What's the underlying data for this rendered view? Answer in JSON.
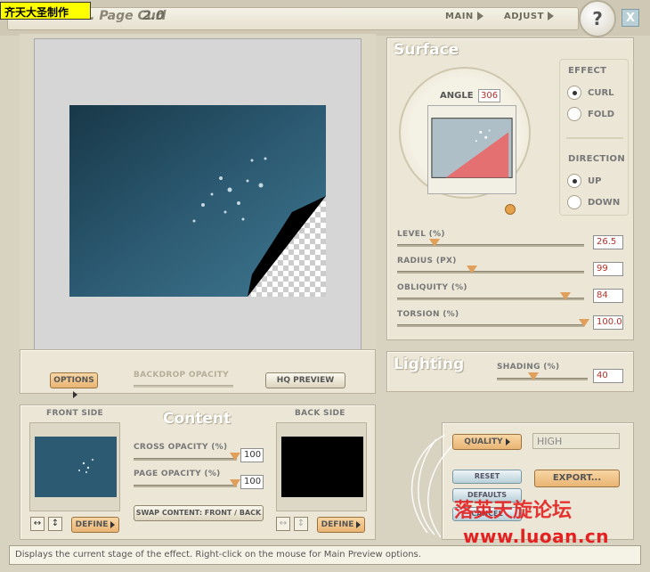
{
  "titlebar": {
    "badge": "齐天大圣制作",
    "title": "AV Bros. Page Curl",
    "version": "2.0",
    "menu_main": "MAIN",
    "menu_adjust": "ADJUST",
    "help": "?",
    "close": "X"
  },
  "surface": {
    "title": "Surface",
    "angle_label": "ANGLE",
    "angle_value": "306",
    "effect_label": "EFFECT",
    "effect_options": [
      "CURL",
      "FOLD"
    ],
    "effect_selected": "CURL",
    "direction_label": "DIRECTION",
    "direction_options": [
      "UP",
      "DOWN"
    ],
    "direction_selected": "UP",
    "sliders": [
      {
        "label": "LEVEL (%)",
        "value": "26.5",
        "fraction": 0.2
      },
      {
        "label": "RADIUS (PX)",
        "value": "99",
        "fraction": 0.4
      },
      {
        "label": "OBLIQUITY (%)",
        "value": "84",
        "fraction": 0.9
      },
      {
        "label": "TORSION (%)",
        "value": "100.0",
        "fraction": 1.0
      }
    ]
  },
  "options": {
    "options_btn": "OPTIONS",
    "backdrop_label": "BACKDROP OPACITY",
    "hq_preview": "HQ PREVIEW"
  },
  "lighting": {
    "title": "Lighting",
    "shading_label": "SHADING (%)",
    "shading_value": "40",
    "shading_fraction": 0.4
  },
  "content": {
    "title": "Content",
    "front_label": "FRONT SIDE",
    "back_label": "BACK SIDE",
    "cross_label": "CROSS OPACITY (%)",
    "cross_value": "100",
    "page_label": "PAGE OPACITY (%)",
    "page_value": "100",
    "swap_btn": "SWAP CONTENT: FRONT / BACK",
    "define": "DEFINE",
    "flip_h": "↔",
    "flip_v": "↕"
  },
  "actions": {
    "quality_btn": "QUALITY",
    "quality_value": "HIGH",
    "reset": "RESET",
    "defaults": "DEFAULTS",
    "cancel": "CANCEL",
    "export": "EXPORT..."
  },
  "watermark": {
    "cn": "落英天旋论坛",
    "url": "www.luoan.cn"
  },
  "status": "Displays the current stage of the effect. Right-click on the mouse for Main Preview options.",
  "colors": {
    "accent_orange": "#e0a05c",
    "value_red": "#b5302a",
    "preview_blue": "#2c5a72"
  }
}
